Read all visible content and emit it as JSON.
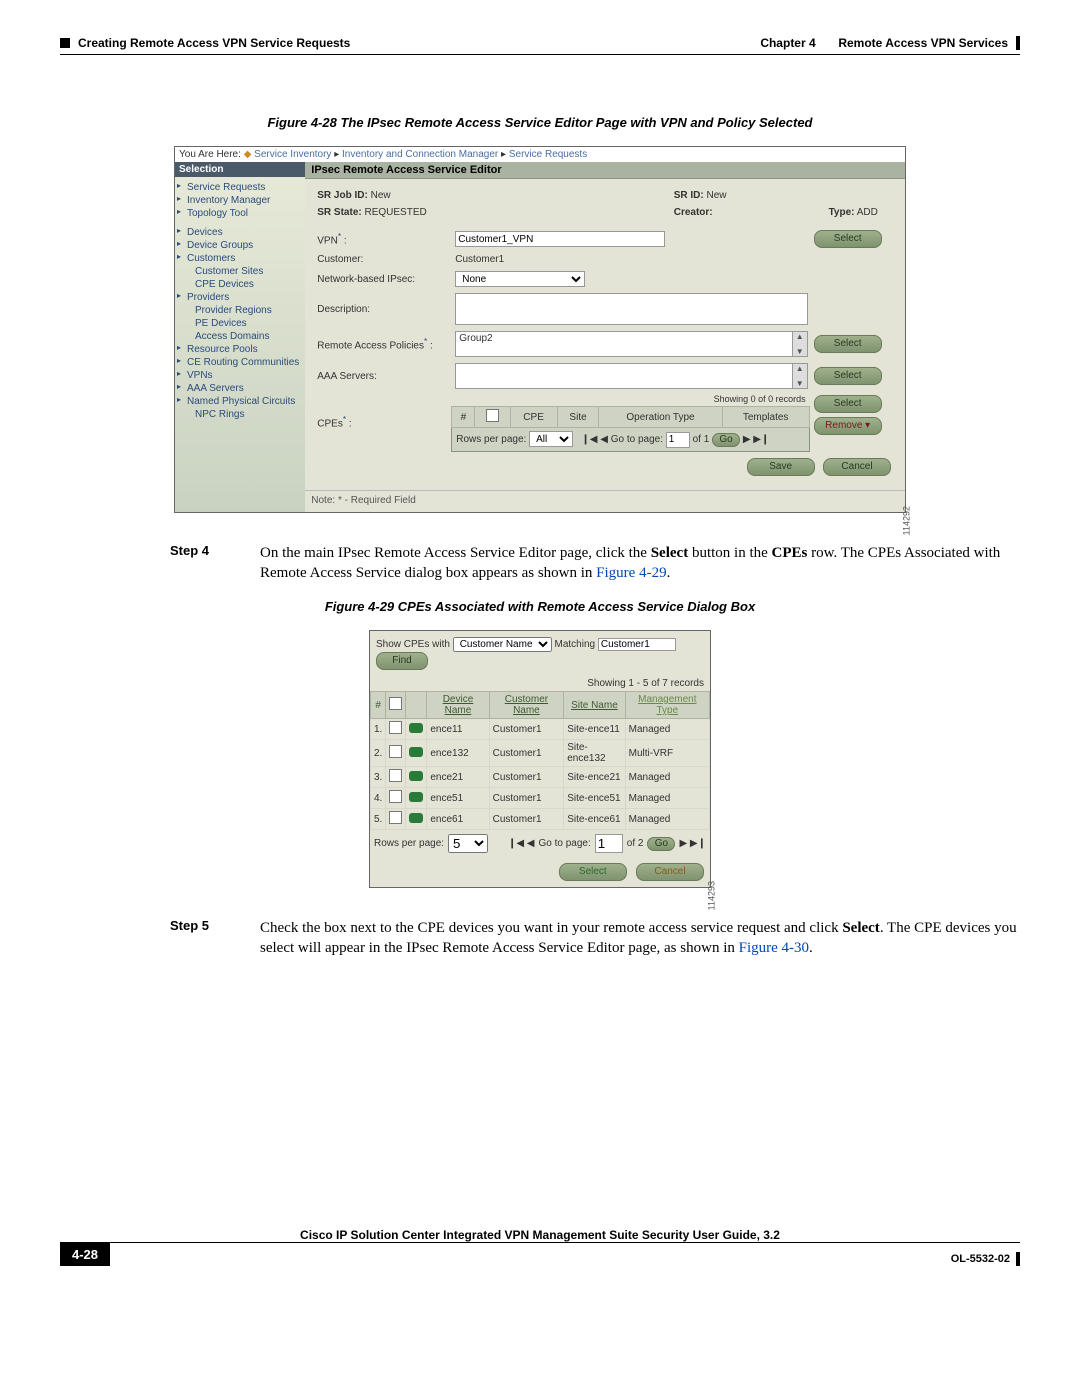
{
  "header": {
    "chapter": "Chapter 4",
    "chapterTitle": "Remote Access VPN Services",
    "section": "Creating Remote Access VPN Service Requests"
  },
  "fig28": {
    "caption": "Figure 4-28   The IPsec Remote Access Service Editor Page with VPN and Policy Selected",
    "breadcrumb": {
      "prefix": "You Are Here: ",
      "p1": "Service Inventory",
      "p2": "Inventory and Connection Manager",
      "p3": "Service Requests"
    },
    "navHeader": "Selection",
    "nav": [
      "Service Requests",
      "Inventory Manager",
      "Topology Tool",
      "",
      "Devices",
      "Device Groups",
      "Customers",
      "Customer Sites",
      "CPE Devices",
      "Providers",
      "Provider Regions",
      "PE Devices",
      "Access Domains",
      "Resource Pools",
      "CE Routing Communities",
      "VPNs",
      "AAA Servers",
      "Named Physical Circuits",
      "NPC Rings"
    ],
    "mainTitle": "IPsec Remote Access Service Editor",
    "info": {
      "srJobLabel": "SR Job ID:",
      "srJob": "New",
      "srStateLabel": "SR State:",
      "srState": "REQUESTED",
      "srIdLabel": "SR ID:",
      "srId": "New",
      "creatorLabel": "Creator:",
      "creator": "",
      "typeLabel": "Type:",
      "type": "ADD"
    },
    "form": {
      "vpnLabel": "VPN",
      "vpnValue": "Customer1_VPN",
      "customerLabel": "Customer:",
      "customerValue": "Customer1",
      "ipsecLabel": "Network-based IPsec:",
      "ipsecValue": "None",
      "descLabel": "Description:",
      "policiesLabel": "Remote Access Policies",
      "policiesValue": "Group2",
      "aaaLabel": "AAA Servers:",
      "cpesLabel": "CPEs",
      "cpeShowing": "Showing 0 of 0 records",
      "cpeHeaders": {
        "num": "#",
        "cpe": "CPE",
        "site": "Site",
        "op": "Operation Type",
        "tpl": "Templates"
      },
      "rowsPerPageLabel": "Rows per page:",
      "rowsPerPageValue": "All",
      "gotoLabel": "Go to page:",
      "gotoValue": "1",
      "ofLabel": "of 1",
      "btnSelect": "Select",
      "btnRemove": "Remove",
      "btnSave": "Save",
      "btnCancel": "Cancel",
      "btnGo": "Go"
    },
    "note": "Note: * - Required Field",
    "sideNum": "114292"
  },
  "step4": {
    "label": "Step 4",
    "text_a": "On the main IPsec Remote Access Service Editor page, click the ",
    "bold1": "Select",
    "text_b": " button in the ",
    "bold2": "CPEs",
    "text_c": " row. The CPEs Associated with Remote Access Service dialog box appears as shown in ",
    "link": "Figure 4-29",
    "text_d": "."
  },
  "fig29": {
    "caption": "Figure 4-29   CPEs Associated with Remote Access Service Dialog Box",
    "filter": {
      "showLabel": "Show CPEs with",
      "col": "Customer Name",
      "matchLabel": "Matching",
      "matchVal": "Customer1",
      "btnFind": "Find"
    },
    "count": "Showing 1 - 5 of 7 records",
    "headers": {
      "num": "#",
      "dev": "Device Name",
      "cust": "Customer Name",
      "site": "Site Name",
      "mgmt": "Management Type"
    },
    "rows": [
      {
        "n": "1.",
        "dev": "ence11",
        "cust": "Customer1",
        "site": "Site-ence11",
        "mgmt": "Managed"
      },
      {
        "n": "2.",
        "dev": "ence132",
        "cust": "Customer1",
        "site": "Site-ence132",
        "mgmt": "Multi-VRF"
      },
      {
        "n": "3.",
        "dev": "ence21",
        "cust": "Customer1",
        "site": "Site-ence21",
        "mgmt": "Managed"
      },
      {
        "n": "4.",
        "dev": "ence51",
        "cust": "Customer1",
        "site": "Site-ence51",
        "mgmt": "Managed"
      },
      {
        "n": "5.",
        "dev": "ence61",
        "cust": "Customer1",
        "site": "Site-ence61",
        "mgmt": "Managed"
      }
    ],
    "ctrl": {
      "rowsLabel": "Rows per page:",
      "rowsVal": "5",
      "gotoLabel": "Go to page:",
      "gotoVal": "1",
      "ofLabel": "of 2",
      "btnGo": "Go"
    },
    "btnSelect": "Select",
    "btnCancel": "Cancel",
    "sideNum": "114293"
  },
  "step5": {
    "label": "Step 5",
    "text_a": "Check the box next to the CPE devices you want in your remote access service request and click ",
    "bold1": "Select",
    "text_b": ". The CPE devices you select will appear in the IPsec Remote Access Service Editor page, as shown in ",
    "link": "Figure 4-30",
    "text_c": "."
  },
  "footer": {
    "title": "Cisco IP Solution Center Integrated VPN Management Suite Security User Guide, 3.2",
    "pageNum": "4-28",
    "doc": "OL-5532-02"
  }
}
